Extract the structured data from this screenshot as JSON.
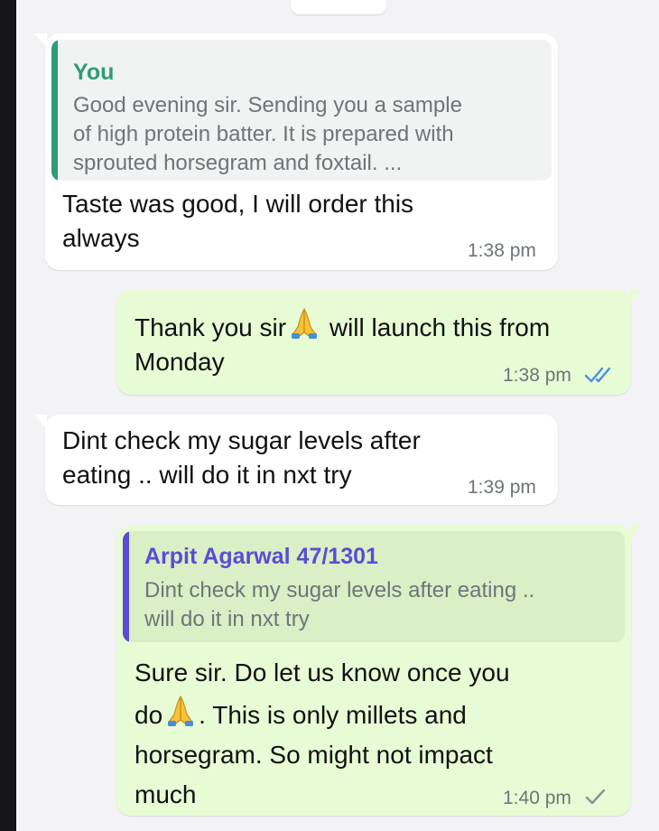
{
  "colors": {
    "incoming_bubble": "#ffffff",
    "outgoing_bubble": "#e7fcd5",
    "you_accent": "#2e9d77",
    "contact_accent": "#5b4bd6",
    "read_ticks": "#4c8fe0",
    "sent_tick": "#8b8f92"
  },
  "messages": [
    {
      "direction": "incoming",
      "reply": {
        "author": "You",
        "lines": [
          "Good evening sir. Sending you a sample",
          "of high protein batter. It is prepared with",
          "sprouted horsegram and foxtail. ..."
        ]
      },
      "lines": [
        "Taste was good, I will order this",
        "always"
      ],
      "time": "1:38 pm"
    },
    {
      "direction": "outgoing",
      "lines": {
        "part1": "Thank you sir",
        "emoji1": "folded-hands-emoji",
        "part2": " will launch this from",
        "line2": "Monday"
      },
      "time": "1:38 pm",
      "status": "read-double-tick-icon"
    },
    {
      "direction": "incoming",
      "lines": [
        "Dint check my sugar  levels after",
        "eating .. will do it in nxt try"
      ],
      "time": "1:39 pm"
    },
    {
      "direction": "outgoing",
      "reply": {
        "author": "Arpit Agarwal 47/1301",
        "lines": [
          "Dint check my sugar  levels after eating ..",
          "will do it in nxt try"
        ]
      },
      "lines": {
        "line1": "Sure sir. Do let us know once you",
        "line2a": "do",
        "emoji": "folded-hands-emoji",
        "line2b": ". This is only millets and",
        "line3": "horsegram. So might not impact",
        "line4": "much"
      },
      "time": "1:40 pm",
      "status": "sent-single-tick-icon"
    }
  ]
}
